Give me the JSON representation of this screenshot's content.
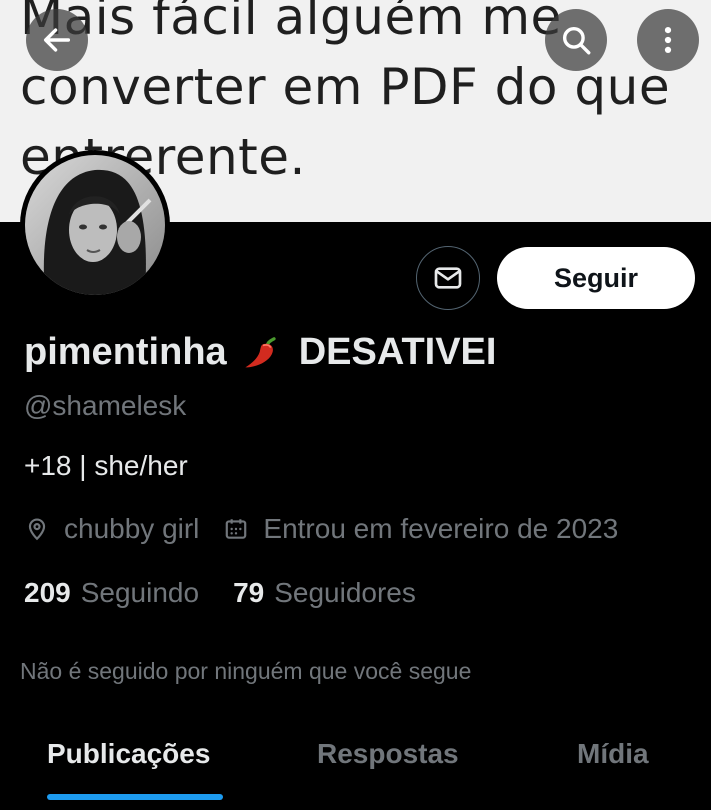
{
  "banner": {
    "lines": [
      "Mais fácil alguém me",
      "converter em PDF do que",
      "entrerente."
    ]
  },
  "header": {
    "back_icon": "arrow-left-icon",
    "search_icon": "search-icon",
    "more_icon": "more-vertical-icon"
  },
  "profile": {
    "display_name": "pimentinha",
    "name_emoji": "🌶️",
    "name_suffix": "DESATIVEI",
    "handle": "@shamelesk",
    "bio": "+18 | she/her",
    "location": "chubby girl",
    "joined": "Entrou em fevereiro de 2023",
    "following_count": "209",
    "following_label": "Seguindo",
    "followers_count": "79",
    "followers_label": "Seguidores",
    "followers_note": "Não é seguido por ninguém que você segue"
  },
  "actions": {
    "message_icon": "envelope-icon",
    "follow_label": "Seguir"
  },
  "tabs": [
    {
      "label": "Publicações",
      "active": true
    },
    {
      "label": "Respostas",
      "active": false
    },
    {
      "label": "Mídia",
      "active": false
    }
  ],
  "colors": {
    "accent": "#1d9bf0",
    "background": "#000000",
    "muted_text": "#71767b",
    "primary_text": "#e7e9ea"
  }
}
